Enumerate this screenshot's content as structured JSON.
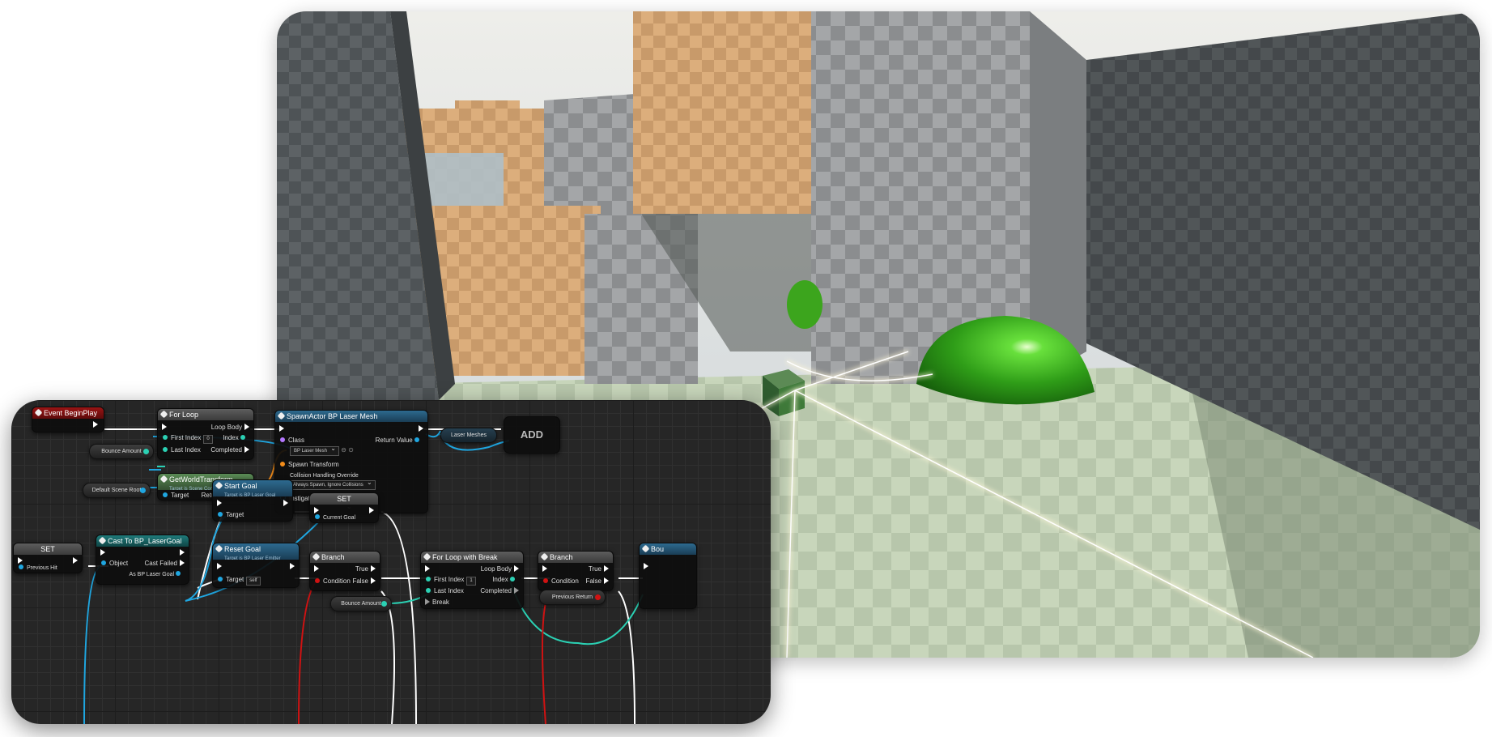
{
  "graph": {
    "event_begin_play": "Event BeginPlay",
    "for_loop": {
      "title": "For Loop",
      "loop_body": "Loop Body",
      "first_index": "First Index",
      "first_index_value": "0",
      "index": "Index",
      "last_index": "Last Index",
      "completed": "Completed"
    },
    "bounce_amount_var": "Bounce Amount",
    "spawn_actor": {
      "title": "SpawnActor BP Laser Mesh",
      "class": "Class",
      "class_value": "BP Laser Mesh",
      "return_value": "Return Value",
      "spawn_transform": "Spawn Transform",
      "collision_override": "Collision Handling Override",
      "collision_value": "Always Spawn, Ignore Collisions",
      "instigator": "Instigator"
    },
    "laser_meshes_var": "Laser Meshes",
    "add_node": "ADD",
    "get_world_transform": {
      "title": "GetWorldTransform",
      "subtitle": "Target is Scene Component",
      "target": "Target",
      "return_value": "Return Value"
    },
    "default_scene_root_var": "Default Scene Root",
    "start_goal": {
      "title": "Start Goal",
      "subtitle": "Target is BP Laser Goal",
      "target": "Target"
    },
    "set_top": {
      "title": "SET",
      "current_goal": "Current Goal"
    },
    "set_left": {
      "title": "SET",
      "previous_hit": "Previous Hit"
    },
    "cast": {
      "title": "Cast To BP_LaserGoal",
      "object": "Object",
      "cast_failed": "Cast Failed",
      "as_goal": "As BP Laser Goal"
    },
    "reset_goal": {
      "title": "Reset Goal",
      "subtitle": "Target is BP Laser Emitter",
      "target": "Target",
      "target_value": "self"
    },
    "branch1": {
      "title": "Branch",
      "true": "True",
      "condition": "Condition",
      "false": "False"
    },
    "bounce_amount_var2": "Bounce Amount",
    "for_loop_break": {
      "title": "For Loop with Break",
      "loop_body": "Loop Body",
      "first_index": "First Index",
      "first_index_value": "1",
      "index": "Index",
      "last_index": "Last Index",
      "completed": "Completed",
      "break": "Break"
    },
    "branch2": {
      "title": "Branch",
      "true": "True",
      "condition": "Condition",
      "false": "False"
    },
    "previous_return_var": "Previous Return",
    "bounce_partial": "Bou"
  },
  "colors": {
    "exec": "#ffffff",
    "object_pin": "#1fa6e0",
    "struct_pin": "#f28c1a",
    "int_pin": "#2bd1b4",
    "bool_pin": "#d01212",
    "class_pin": "#b478ff",
    "goal_sphere": "#3fbf1c"
  }
}
